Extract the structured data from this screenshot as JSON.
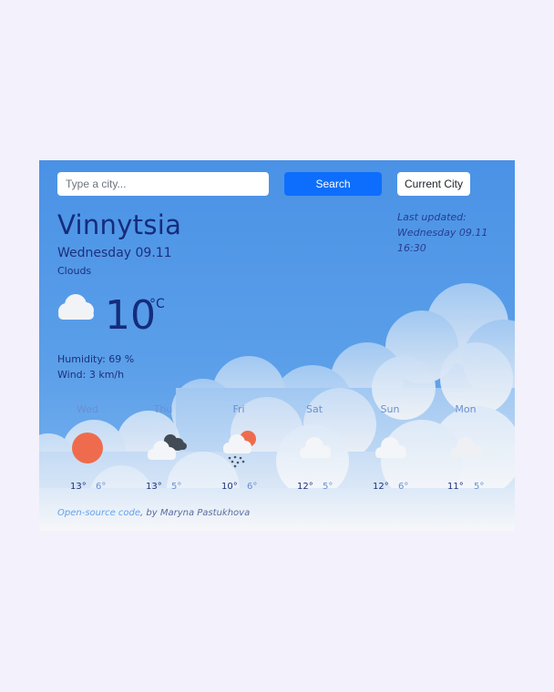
{
  "search": {
    "placeholder": "Type a city...",
    "value": ""
  },
  "buttons": {
    "search_label": "Search",
    "current_label": "Current City"
  },
  "current": {
    "city": "Vinnytsia",
    "date": "Wednesday 09.11",
    "description": "Clouds",
    "temperature": "10",
    "unit": "°C",
    "humidity": "Humidity: 69 %",
    "wind": "Wind: 3 km/h",
    "icon": "cloud-icon"
  },
  "last_updated": {
    "label": "Last updated:",
    "date": "Wednesday 09.11",
    "time": "16:30"
  },
  "forecast": [
    {
      "day": "Wed",
      "max": "13°",
      "min": "6°",
      "icon": "sun-icon"
    },
    {
      "day": "Thu",
      "max": "13°",
      "min": "5°",
      "icon": "broken-clouds-icon"
    },
    {
      "day": "Fri",
      "max": "10°",
      "min": "6°",
      "icon": "sun-rain-icon"
    },
    {
      "day": "Sat",
      "max": "12°",
      "min": "5°",
      "icon": "cloud-icon"
    },
    {
      "day": "Sun",
      "max": "12°",
      "min": "6°",
      "icon": "cloud-icon"
    },
    {
      "day": "Mon",
      "max": "11°",
      "min": "5°",
      "icon": "cloud-icon"
    }
  ],
  "footer": {
    "link_text": "Open-source code",
    "author": ", by Maryna Pastukhova"
  },
  "colors": {
    "accent": "#0d6efd",
    "sun": "#ee6c4d",
    "card": "#4a92e6"
  }
}
